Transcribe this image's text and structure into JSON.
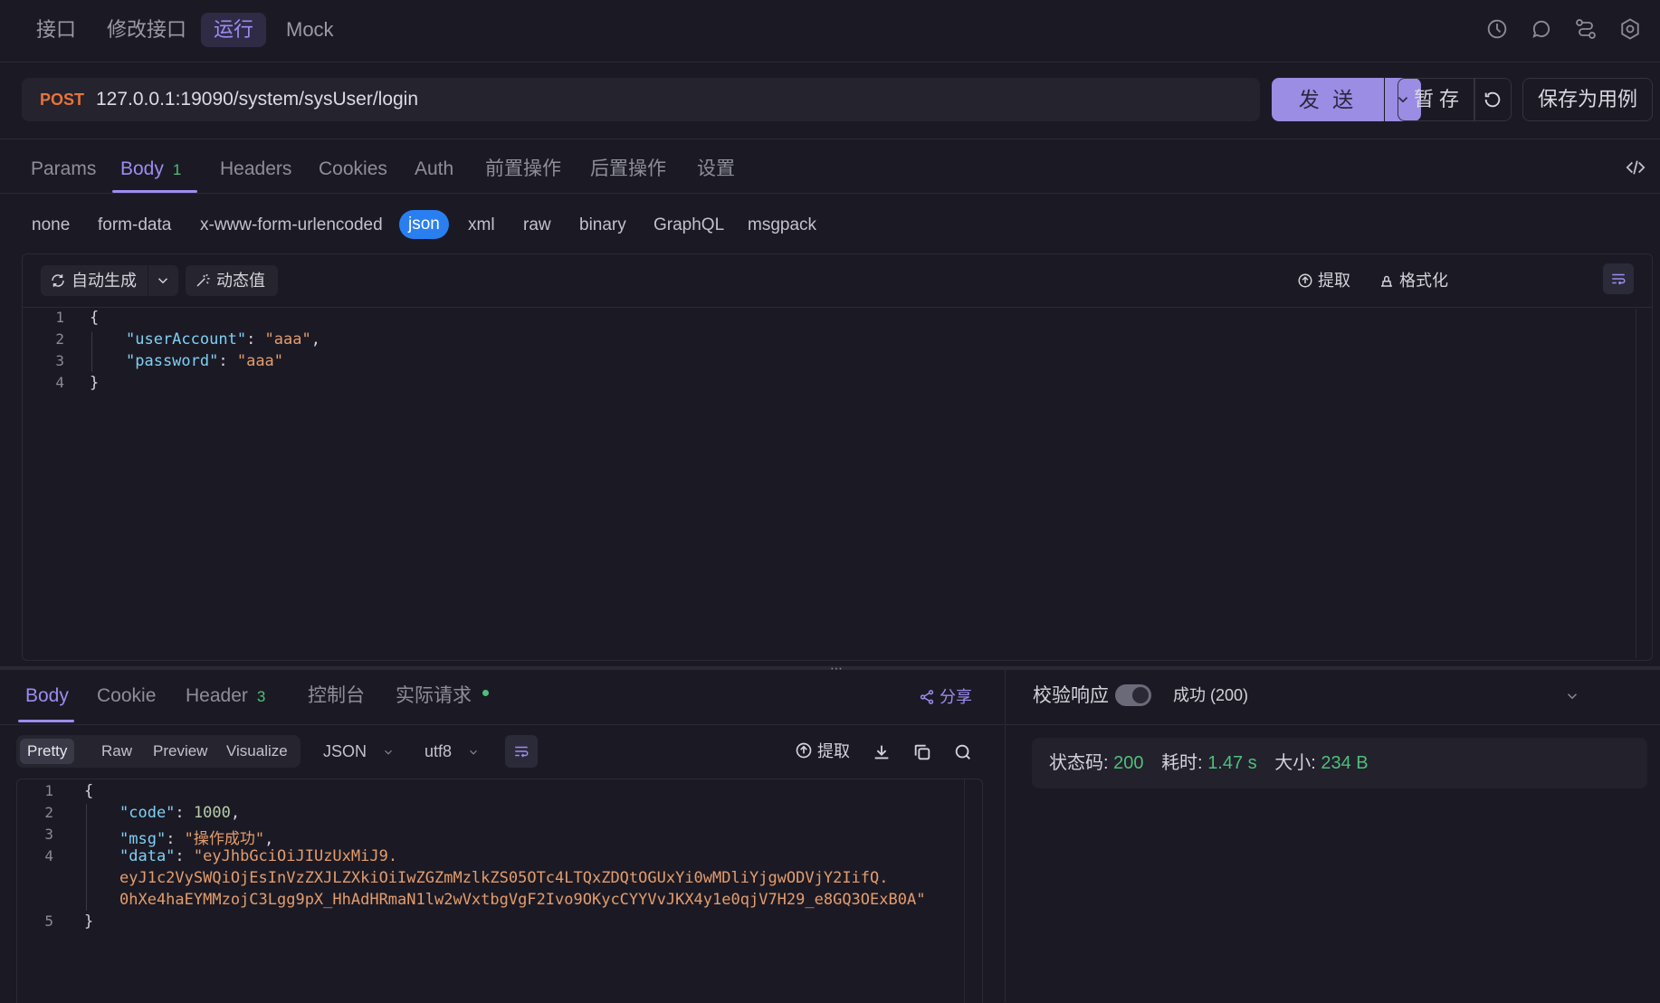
{
  "top_tabs": [
    "接口",
    "修改接口",
    "运行",
    "Mock"
  ],
  "request": {
    "method": "POST",
    "url": "127.0.0.1:19090/system/sysUser/login",
    "send_label": "发 送",
    "stash_label": "暂 存",
    "save_case_label": "保存为用例"
  },
  "request_tabs": {
    "params": "Params",
    "body": "Body",
    "body_count": "1",
    "headers": "Headers",
    "cookies": "Cookies",
    "auth": "Auth",
    "pre": "前置操作",
    "post": "后置操作",
    "settings": "设置"
  },
  "body_types": [
    "none",
    "form-data",
    "x-www-form-urlencoded",
    "json",
    "xml",
    "raw",
    "binary",
    "GraphQL",
    "msgpack"
  ],
  "editor_toolbar": {
    "auto_generate": "自动生成",
    "dynamic_value": "动态值",
    "extract": "提取",
    "format": "格式化"
  },
  "request_body_lines": [
    {
      "n": "1",
      "text": "{"
    },
    {
      "n": "2",
      "key": "\"userAccount\"",
      "value": "\"aaa\"",
      "trail": ","
    },
    {
      "n": "3",
      "key": "\"password\"",
      "value": "\"aaa\"",
      "trail": ""
    },
    {
      "n": "4",
      "text": "}"
    }
  ],
  "response_tabs": {
    "body": "Body",
    "cookie": "Cookie",
    "header": "Header",
    "header_count": "3",
    "console": "控制台",
    "actual_request": "实际请求",
    "share": "分享"
  },
  "view_modes": [
    "Pretty",
    "Raw",
    "Preview",
    "Visualize"
  ],
  "format_select": "JSON",
  "encoding_select": "utf8",
  "response_toolbar": {
    "extract": "提取"
  },
  "response_lines": {
    "l1_n": "1",
    "l1": "{",
    "l2_n": "2",
    "l2_key": "\"code\"",
    "l2_val": "1000",
    "l3_n": "3",
    "l3_key": "\"msg\"",
    "l3_val": "\"操作成功\"",
    "l4_n": "4",
    "l4_key": "\"data\"",
    "l4_val_1": "\"eyJhbGciOiJIUzUxMiJ9.",
    "l4_val_2": "eyJ1c2VySWQiOjEsInVzZXJLZXkiOiIwZGZmMzlkZS05OTc4LTQxZDQtOGUxYi0wMDliYjgwODVjY2IifQ.",
    "l4_val_3": "0hXe4haEYMMzojC3Lgg9pX_HhAdHRmaN1lw2wVxtbgVgF2Ivo9OKycCYYVvJKX4y1e0qjV7H29_e8GQ3OExB0A\"",
    "l5_n": "5",
    "l5": "}"
  },
  "validation": {
    "label": "校验响应",
    "status_text": "成功 (200)"
  },
  "stats": {
    "status_label": "状态码:",
    "status_value": "200",
    "time_label": "耗时:",
    "time_value": "1.47 s",
    "size_label": "大小:",
    "size_value": "234 B"
  },
  "colors": {
    "accent": "#9d8cf0",
    "method": "#e8733a",
    "json_active": "#2a7ff0",
    "success": "#4fbf7a"
  }
}
